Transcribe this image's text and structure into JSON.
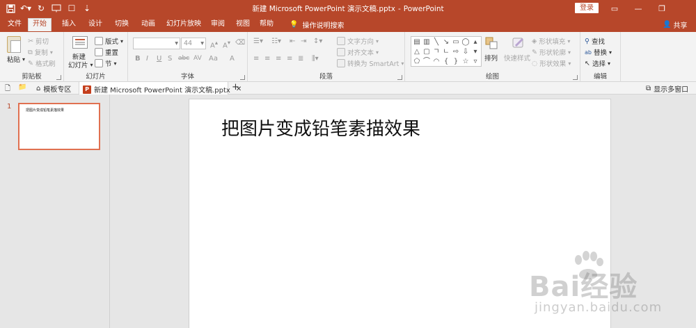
{
  "window": {
    "title_file": "新建 Microsoft PowerPoint 演示文稿.pptx",
    "title_sep": "-",
    "title_app": "PowerPoint",
    "login_label": "登录"
  },
  "tabs": [
    {
      "label": "文件"
    },
    {
      "label": "开始"
    },
    {
      "label": "插入"
    },
    {
      "label": "设计"
    },
    {
      "label": "切换"
    },
    {
      "label": "动画"
    },
    {
      "label": "幻灯片放映"
    },
    {
      "label": "审阅"
    },
    {
      "label": "视图"
    },
    {
      "label": "帮助"
    }
  ],
  "tell_me": "操作说明搜索",
  "share": "共享",
  "ribbon": {
    "clipboard": {
      "label": "剪贴板",
      "paste": "粘贴",
      "cut": "剪切",
      "copy": "复制",
      "format_painter": "格式刷"
    },
    "slides": {
      "label": "幻灯片",
      "new_slide_1": "新建",
      "new_slide_2": "幻灯片",
      "layout": "版式",
      "reset": "重置",
      "section": "节"
    },
    "font": {
      "label": "字体",
      "size": "44",
      "bold": "B",
      "italic": "I",
      "underline": "U",
      "shadow": "S",
      "strike": "abc",
      "spacing": "AV",
      "case": "Aa",
      "clear": "A"
    },
    "paragraph": {
      "label": "段落",
      "text_direction": "文字方向",
      "align_text": "对齐文本",
      "smartart": "转换为 SmartArt"
    },
    "drawing": {
      "label": "绘图",
      "arrange": "排列",
      "quick_styles": "快速样式",
      "shape_fill": "形状填充",
      "shape_outline": "形状轮廓",
      "shape_effects": "形状效果"
    },
    "editing": {
      "label": "编辑",
      "find": "查找",
      "replace": "替换",
      "select": "选择"
    }
  },
  "filebar": {
    "template_zone": "模板专区",
    "doc_tab": "新建 Microsoft PowerPoint 演示文稿.pptx",
    "multi_window": "显示多窗口"
  },
  "slides": [
    {
      "number": "1",
      "title": "把图片变成铅笔素描效果"
    }
  ],
  "watermark": {
    "brand": "Bai经验",
    "url": "jingyan.baidu.com"
  },
  "colors": {
    "accent": "#b7472a",
    "ribbon_bg": "#f3f3f3",
    "workspace_bg": "#e6e6e6",
    "thumb_border": "#e07050"
  }
}
